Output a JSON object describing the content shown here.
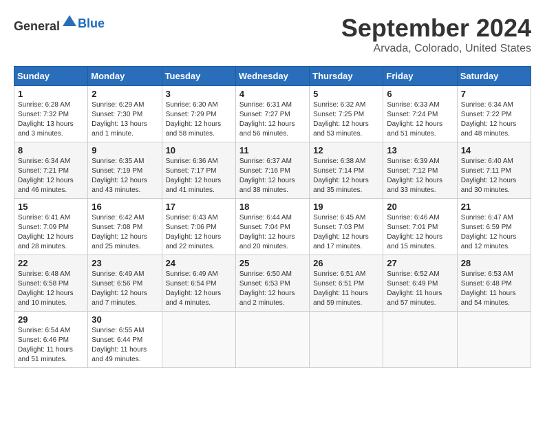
{
  "header": {
    "logo_general": "General",
    "logo_blue": "Blue",
    "month": "September 2024",
    "location": "Arvada, Colorado, United States"
  },
  "weekdays": [
    "Sunday",
    "Monday",
    "Tuesday",
    "Wednesday",
    "Thursday",
    "Friday",
    "Saturday"
  ],
  "weeks": [
    [
      {
        "day": "1",
        "sunrise": "6:28 AM",
        "sunset": "7:32 PM",
        "daylight": "13 hours and 3 minutes."
      },
      {
        "day": "2",
        "sunrise": "6:29 AM",
        "sunset": "7:30 PM",
        "daylight": "13 hours and 1 minute."
      },
      {
        "day": "3",
        "sunrise": "6:30 AM",
        "sunset": "7:29 PM",
        "daylight": "12 hours and 58 minutes."
      },
      {
        "day": "4",
        "sunrise": "6:31 AM",
        "sunset": "7:27 PM",
        "daylight": "12 hours and 56 minutes."
      },
      {
        "day": "5",
        "sunrise": "6:32 AM",
        "sunset": "7:25 PM",
        "daylight": "12 hours and 53 minutes."
      },
      {
        "day": "6",
        "sunrise": "6:33 AM",
        "sunset": "7:24 PM",
        "daylight": "12 hours and 51 minutes."
      },
      {
        "day": "7",
        "sunrise": "6:34 AM",
        "sunset": "7:22 PM",
        "daylight": "12 hours and 48 minutes."
      }
    ],
    [
      {
        "day": "8",
        "sunrise": "6:34 AM",
        "sunset": "7:21 PM",
        "daylight": "12 hours and 46 minutes."
      },
      {
        "day": "9",
        "sunrise": "6:35 AM",
        "sunset": "7:19 PM",
        "daylight": "12 hours and 43 minutes."
      },
      {
        "day": "10",
        "sunrise": "6:36 AM",
        "sunset": "7:17 PM",
        "daylight": "12 hours and 41 minutes."
      },
      {
        "day": "11",
        "sunrise": "6:37 AM",
        "sunset": "7:16 PM",
        "daylight": "12 hours and 38 minutes."
      },
      {
        "day": "12",
        "sunrise": "6:38 AM",
        "sunset": "7:14 PM",
        "daylight": "12 hours and 35 minutes."
      },
      {
        "day": "13",
        "sunrise": "6:39 AM",
        "sunset": "7:12 PM",
        "daylight": "12 hours and 33 minutes."
      },
      {
        "day": "14",
        "sunrise": "6:40 AM",
        "sunset": "7:11 PM",
        "daylight": "12 hours and 30 minutes."
      }
    ],
    [
      {
        "day": "15",
        "sunrise": "6:41 AM",
        "sunset": "7:09 PM",
        "daylight": "12 hours and 28 minutes."
      },
      {
        "day": "16",
        "sunrise": "6:42 AM",
        "sunset": "7:08 PM",
        "daylight": "12 hours and 25 minutes."
      },
      {
        "day": "17",
        "sunrise": "6:43 AM",
        "sunset": "7:06 PM",
        "daylight": "12 hours and 22 minutes."
      },
      {
        "day": "18",
        "sunrise": "6:44 AM",
        "sunset": "7:04 PM",
        "daylight": "12 hours and 20 minutes."
      },
      {
        "day": "19",
        "sunrise": "6:45 AM",
        "sunset": "7:03 PM",
        "daylight": "12 hours and 17 minutes."
      },
      {
        "day": "20",
        "sunrise": "6:46 AM",
        "sunset": "7:01 PM",
        "daylight": "12 hours and 15 minutes."
      },
      {
        "day": "21",
        "sunrise": "6:47 AM",
        "sunset": "6:59 PM",
        "daylight": "12 hours and 12 minutes."
      }
    ],
    [
      {
        "day": "22",
        "sunrise": "6:48 AM",
        "sunset": "6:58 PM",
        "daylight": "12 hours and 10 minutes."
      },
      {
        "day": "23",
        "sunrise": "6:49 AM",
        "sunset": "6:56 PM",
        "daylight": "12 hours and 7 minutes."
      },
      {
        "day": "24",
        "sunrise": "6:49 AM",
        "sunset": "6:54 PM",
        "daylight": "12 hours and 4 minutes."
      },
      {
        "day": "25",
        "sunrise": "6:50 AM",
        "sunset": "6:53 PM",
        "daylight": "12 hours and 2 minutes."
      },
      {
        "day": "26",
        "sunrise": "6:51 AM",
        "sunset": "6:51 PM",
        "daylight": "11 hours and 59 minutes."
      },
      {
        "day": "27",
        "sunrise": "6:52 AM",
        "sunset": "6:49 PM",
        "daylight": "11 hours and 57 minutes."
      },
      {
        "day": "28",
        "sunrise": "6:53 AM",
        "sunset": "6:48 PM",
        "daylight": "11 hours and 54 minutes."
      }
    ],
    [
      {
        "day": "29",
        "sunrise": "6:54 AM",
        "sunset": "6:46 PM",
        "daylight": "11 hours and 51 minutes."
      },
      {
        "day": "30",
        "sunrise": "6:55 AM",
        "sunset": "6:44 PM",
        "daylight": "11 hours and 49 minutes."
      },
      null,
      null,
      null,
      null,
      null
    ]
  ]
}
